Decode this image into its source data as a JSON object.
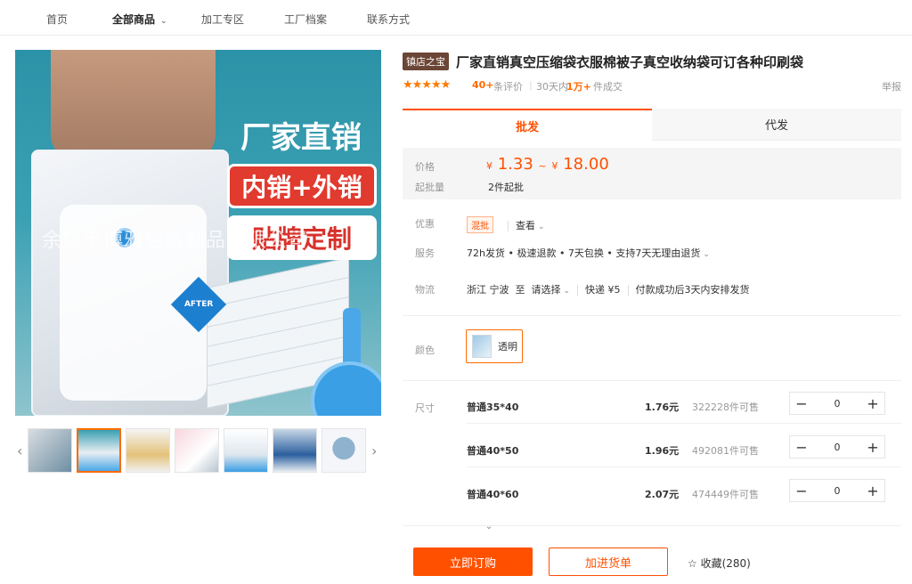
{
  "nav": {
    "items": [
      {
        "label": "首页"
      },
      {
        "label": "全部商品"
      },
      {
        "label": "加工专区"
      },
      {
        "label": "工厂档案"
      },
      {
        "label": "联系方式"
      }
    ]
  },
  "gallery": {
    "banner1": "厂家直销",
    "banner2": "内销+外销",
    "banner3": "贴牌定制",
    "watermark": "余姚市博雅包装制品有限公司",
    "after_tag": "AFTER",
    "thumb_count": 7,
    "selected_thumb": 2
  },
  "product": {
    "shop_tag": "镇店之宝",
    "title": "厂家直销真空压缩袋衣服棉被子真空收纳袋可订各种印刷袋",
    "stars": 4.5,
    "rating_count": "40+",
    "rating_label": "条评价",
    "sold_prefix": "30天内",
    "sold_num": "1万+",
    "sold_suffix": "件成交",
    "report": "举报"
  },
  "tabs": {
    "wholesale": "批发",
    "dropship": "代发"
  },
  "pricing": {
    "price_label": "价格",
    "currency": "¥",
    "min_price": "1.33",
    "range_sep": "~",
    "max_price": "18.00",
    "moq_label": "起批量",
    "moq_value": "2件起批"
  },
  "details": {
    "promo_label": "优惠",
    "promo_badge": "混批",
    "promo_link": "查看",
    "service_label": "服务",
    "service_value": "72h发货 • 极速退款 • 7天包换 • 支持7天无理由退货",
    "logistics_label": "物流",
    "origin": "浙江 宁波",
    "to": "至",
    "dest": "请选择",
    "shipping": "快递 ¥5",
    "ship_note": "付款成功后3天内安排发货"
  },
  "color": {
    "label": "颜色",
    "option": "透明"
  },
  "sizes": {
    "label": "尺寸",
    "rows": [
      {
        "name": "普通35*40",
        "price": "1.76元",
        "stock": "322228件可售",
        "qty": "0"
      },
      {
        "name": "普通40*50",
        "price": "1.96元",
        "stock": "492081件可售",
        "qty": "0"
      },
      {
        "name": "普通40*60",
        "price": "2.07元",
        "stock": "474449件可售",
        "qty": "0"
      }
    ]
  },
  "actions": {
    "order": "立即订购",
    "cart": "加进货单",
    "fav": "收藏(280)"
  },
  "colors": {
    "accent": "#ff5000",
    "shop_tag_bg": "#6b4535"
  }
}
